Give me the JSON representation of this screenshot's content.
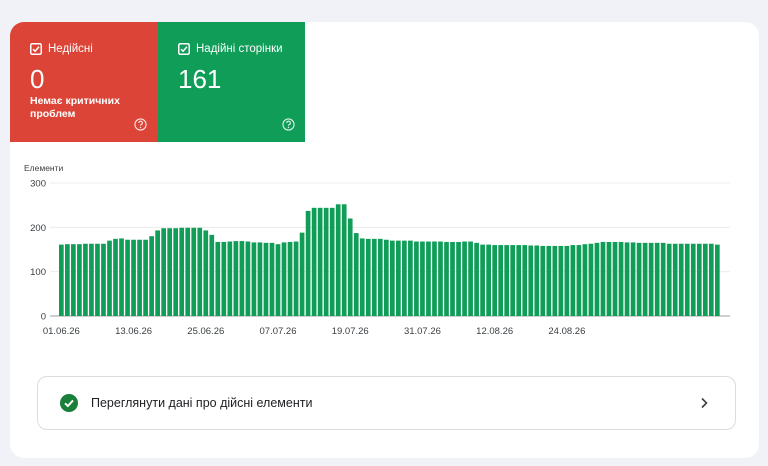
{
  "tiles": {
    "invalid": {
      "label": "Недійсні",
      "value": "0",
      "sub": "Немає критичних проблем",
      "color": "#db4437"
    },
    "valid": {
      "label": "Надійні сторінки",
      "value": "161",
      "color": "#0f9d58"
    }
  },
  "icons": {
    "checkbox": "checkbox-checked-icon",
    "help": "help-circle-icon",
    "ok": "check-circle-icon",
    "chevron": "chevron-right-icon"
  },
  "link": {
    "label": "Переглянути дані про дійсні елементи"
  },
  "chart_data": {
    "type": "bar",
    "ylabel": "Елементи",
    "ylim": [
      0,
      300
    ],
    "yticks": [
      0,
      100,
      200,
      300
    ],
    "grid": true,
    "color": "#0f9d58",
    "xtick_labels": [
      "01.06.26",
      "13.06.26",
      "25.06.26",
      "07.07.26",
      "19.07.26",
      "31.07.26",
      "12.08.26",
      "24.08.26"
    ],
    "xtick_index": [
      0,
      12,
      24,
      36,
      48,
      60,
      72,
      84
    ],
    "values": [
      161,
      162,
      162,
      162,
      163,
      163,
      163,
      163,
      170,
      174,
      175,
      172,
      172,
      172,
      172,
      180,
      193,
      198,
      198,
      198,
      199,
      199,
      199,
      199,
      193,
      183,
      167,
      167,
      168,
      169,
      169,
      168,
      166,
      166,
      165,
      165,
      162,
      166,
      167,
      168,
      188,
      237,
      244,
      244,
      244,
      244,
      252,
      252,
      220,
      187,
      175,
      174,
      174,
      174,
      172,
      170,
      170,
      170,
      170,
      168,
      168,
      168,
      168,
      168,
      167,
      167,
      167,
      168,
      168,
      165,
      161,
      161,
      160,
      160,
      160,
      160,
      160,
      160,
      159,
      159,
      158,
      158,
      158,
      158,
      158,
      160,
      160,
      162,
      163,
      165,
      167,
      167,
      167,
      167,
      166,
      166,
      165,
      165,
      165,
      165,
      165,
      163,
      163,
      163,
      163,
      163,
      163,
      163,
      163,
      161
    ]
  }
}
